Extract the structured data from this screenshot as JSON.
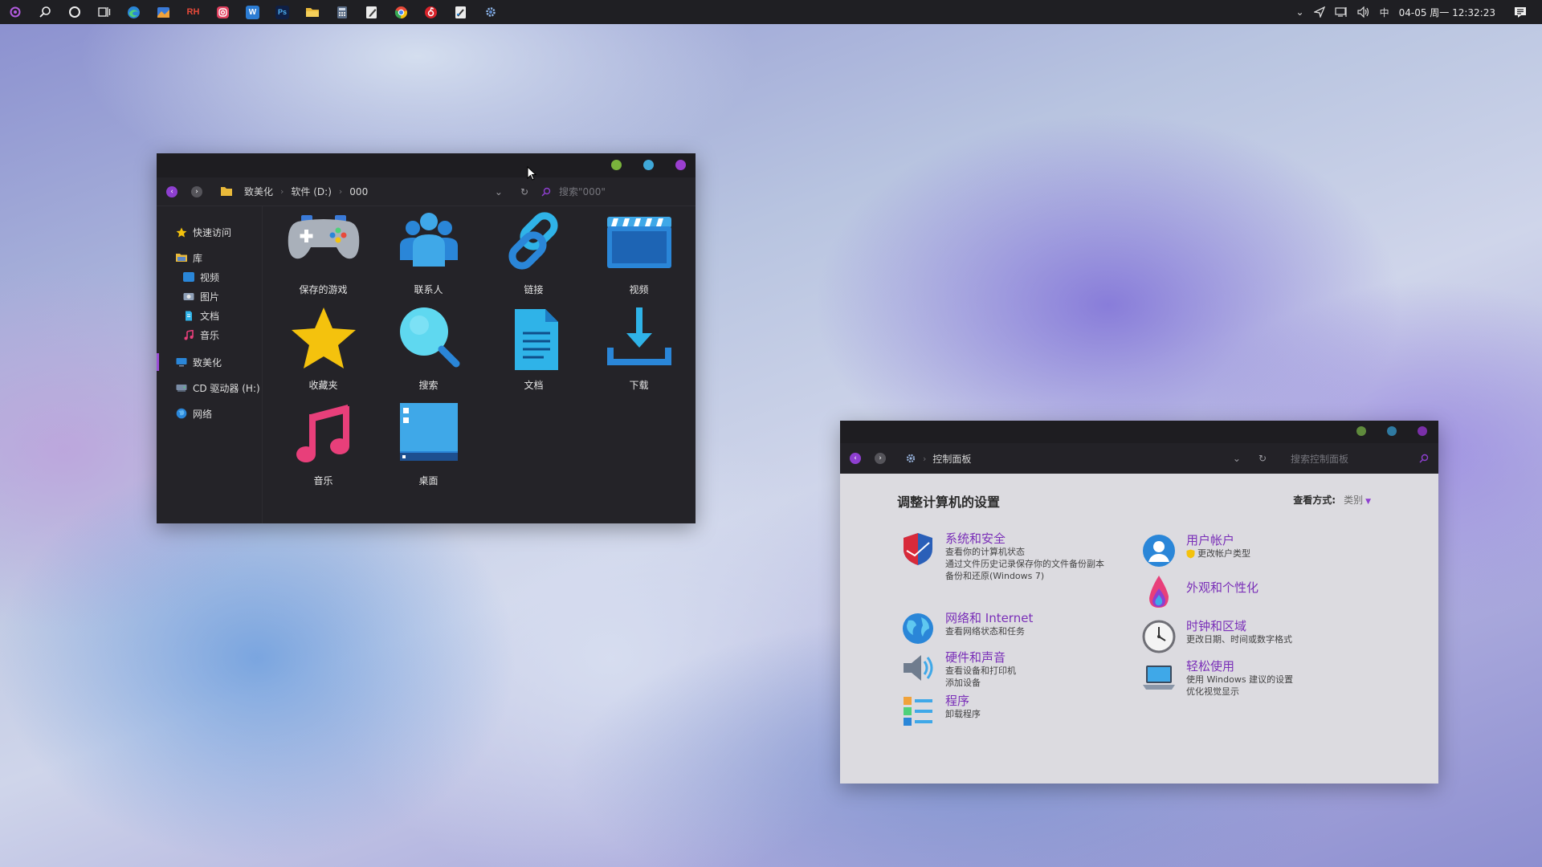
{
  "taskbar": {
    "apps": [
      {
        "name": "start-icon",
        "glyph": "",
        "color": "#a64fd8"
      },
      {
        "name": "search-icon",
        "glyph": "",
        "color": ""
      },
      {
        "name": "cortana-icon",
        "glyph": "",
        "color": ""
      },
      {
        "name": "task-view-icon",
        "glyph": "",
        "color": ""
      },
      {
        "name": "edge-icon",
        "glyph": "",
        "color": "#2a86d8"
      },
      {
        "name": "photos-app-icon",
        "glyph": "",
        "color": "#e8963a"
      },
      {
        "name": "rh-app-icon",
        "glyph": "RH",
        "color": "#1f1f23"
      },
      {
        "name": "instagram-icon",
        "glyph": "",
        "color": "#e0405f"
      },
      {
        "name": "word-icon",
        "glyph": "W",
        "color": "#2b7cd3"
      },
      {
        "name": "photoshop-icon",
        "glyph": "Ps",
        "color": "#1a2b55"
      },
      {
        "name": "file-explorer-icon",
        "glyph": "",
        "color": "#e9b93a"
      },
      {
        "name": "calculator-icon",
        "glyph": "",
        "color": "#5a6c86"
      },
      {
        "name": "notepad-icon",
        "glyph": "",
        "color": "#e8e8e8"
      },
      {
        "name": "chrome-icon",
        "glyph": "",
        "color": "#e84a3a"
      },
      {
        "name": "netease-music-icon",
        "glyph": "",
        "color": "#d8232a"
      },
      {
        "name": "paint-icon",
        "glyph": "",
        "color": "#e8e8e8"
      },
      {
        "name": "control-panel-icon",
        "glyph": "",
        "color": "#5a86c8"
      }
    ],
    "tray": {
      "chevron": "⌄",
      "ime": "中",
      "clock": "04-05 周一 12:32:23"
    }
  },
  "explorer": {
    "breadcrumb": [
      "致美化",
      "软件 (D:)",
      "000"
    ],
    "search_placeholder": "搜索\"000\"",
    "sidebar": [
      {
        "label": "快速访问",
        "icon": "star-icon",
        "sub": false
      },
      {
        "label": "库",
        "icon": "library-icon",
        "sub": false
      },
      {
        "label": "视频",
        "icon": "video-folder-icon",
        "sub": true
      },
      {
        "label": "图片",
        "icon": "pictures-folder-icon",
        "sub": true
      },
      {
        "label": "文档",
        "icon": "documents-folder-icon",
        "sub": true
      },
      {
        "label": "音乐",
        "icon": "music-folder-icon",
        "sub": true
      },
      {
        "label": "致美化",
        "icon": "desktop-pc-icon",
        "sub": false
      },
      {
        "label": "CD 驱动器 (H:)",
        "icon": "cd-drive-icon",
        "sub": false
      },
      {
        "label": "网络",
        "icon": "network-icon",
        "sub": false
      }
    ],
    "items": [
      {
        "label": "保存的游戏",
        "icon": "saved-games-icon"
      },
      {
        "label": "联系人",
        "icon": "contacts-icon"
      },
      {
        "label": "链接",
        "icon": "links-icon"
      },
      {
        "label": "视频",
        "icon": "videos-icon"
      },
      {
        "label": "收藏夹",
        "icon": "favorites-icon"
      },
      {
        "label": "搜索",
        "icon": "searches-icon"
      },
      {
        "label": "文档",
        "icon": "documents-icon"
      },
      {
        "label": "下载",
        "icon": "downloads-icon"
      },
      {
        "label": "音乐",
        "icon": "music-icon"
      },
      {
        "label": "桌面",
        "icon": "desktop-icon"
      }
    ]
  },
  "control_panel": {
    "breadcrumb": "控制面板",
    "search_placeholder": "搜索控制面板",
    "heading": "调整计算机的设置",
    "view_by_label": "查看方式:",
    "view_by_value": "类别",
    "left_categories": [
      {
        "title": "系统和安全",
        "icon": "shield-icon",
        "links": [
          "查看你的计算机状态",
          "通过文件历史记录保存你的文件备份副本",
          "备份和还原(Windows 7)"
        ]
      },
      {
        "title": "网络和 Internet",
        "icon": "globe-icon",
        "links": [
          "查看网络状态和任务"
        ]
      },
      {
        "title": "硬件和声音",
        "icon": "speaker-icon",
        "links": [
          "查看设备和打印机",
          "添加设备"
        ]
      },
      {
        "title": "程序",
        "icon": "programs-icon",
        "links": [
          "卸载程序"
        ]
      }
    ],
    "right_categories": [
      {
        "title": "用户帐户",
        "icon": "user-account-icon",
        "links": [
          "更改帐户类型"
        ]
      },
      {
        "title": "外观和个性化",
        "icon": "appearance-icon",
        "links": []
      },
      {
        "title": "时钟和区域",
        "icon": "clock-icon",
        "links": [
          "更改日期、时间或数字格式"
        ]
      },
      {
        "title": "轻松使用",
        "icon": "ease-of-access-icon",
        "links": [
          "使用 Windows 建议的设置",
          "优化视觉显示"
        ]
      }
    ]
  },
  "colors": {
    "accent": "#9b4fd6",
    "dot_green": "#7ab33c",
    "dot_blue": "#3fa8d8",
    "dot_purple": "#9b3fd0",
    "link_purple": "#7a2fb8"
  }
}
